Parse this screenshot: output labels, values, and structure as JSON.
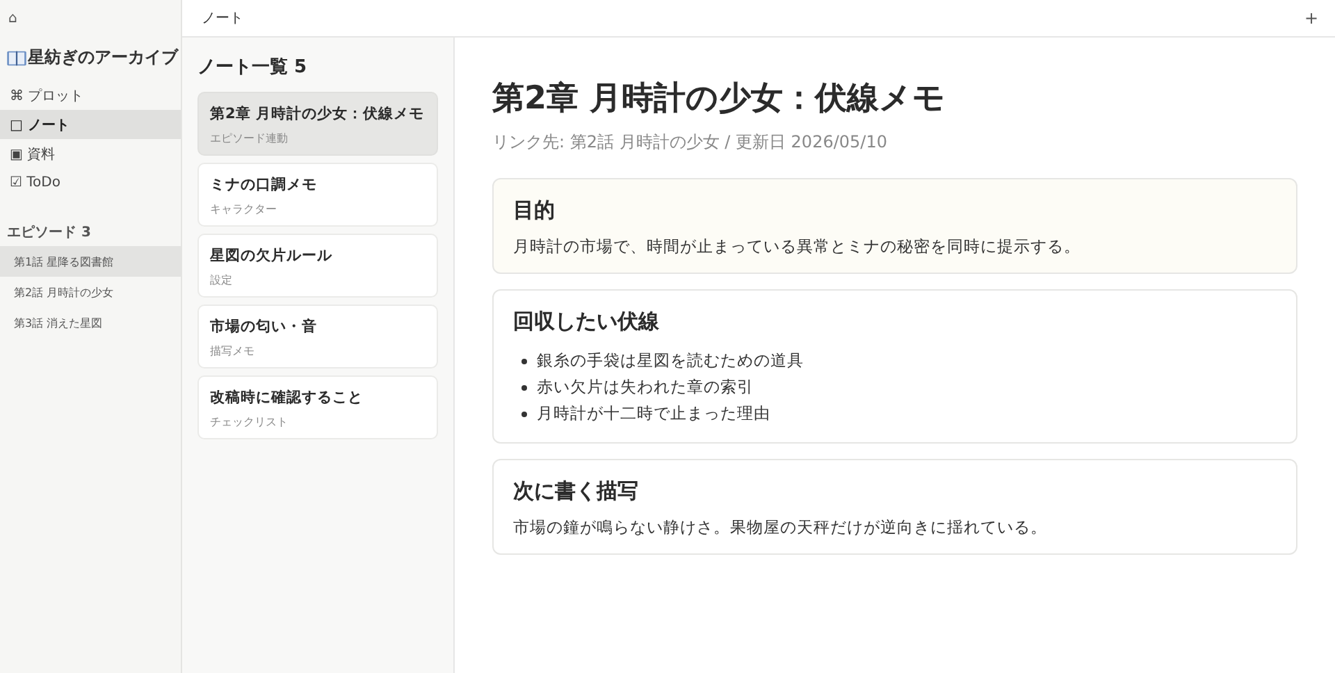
{
  "sidebar": {
    "home": "⌂",
    "title": "星紡ぎのアーカイブ",
    "nav": [
      {
        "label": "⌘ プロット",
        "selected": false
      },
      {
        "label": "□ ノート",
        "selected": true
      },
      {
        "label": "▣ 資料",
        "selected": false
      },
      {
        "label": "☑ ToDo",
        "selected": false
      }
    ],
    "episodes_heading": "エピソード 3",
    "episodes": [
      {
        "label": "第1話 星降る図書館",
        "selected": true
      },
      {
        "label": "第2話 月時計の少女",
        "selected": false
      },
      {
        "label": "第3話 消えた星図",
        "selected": false
      }
    ]
  },
  "header": {
    "title": "ノート",
    "add": "+"
  },
  "note_list": {
    "heading": "ノート一覧 5",
    "notes": [
      {
        "title": "第2章 月時計の少女：伏線メモ",
        "tag": "エピソード連動",
        "selected": true
      },
      {
        "title": "ミナの口調メモ",
        "tag": "キャラクター",
        "selected": false
      },
      {
        "title": "星図の欠片ルール",
        "tag": "設定",
        "selected": false
      },
      {
        "title": "市場の匂い・音",
        "tag": "描写メモ",
        "selected": false
      },
      {
        "title": "改稿時に確認すること",
        "tag": "チェックリスト",
        "selected": false
      }
    ]
  },
  "note": {
    "title": "第2章 月時計の少女：伏線メモ",
    "meta": "リンク先: 第2話 月時計の少女 / 更新日 2026/05/10",
    "sections": [
      {
        "kind": "highlight",
        "heading": "目的",
        "text": "月時計の市場で、時間が止まっている異常とミナの秘密を同時に提示する。"
      },
      {
        "kind": "list",
        "heading": "回収したい伏線",
        "items": [
          "銀糸の手袋は星図を読むための道具",
          "赤い欠片は失われた章の索引",
          "月時計が十二時で止まった理由"
        ]
      },
      {
        "kind": "plain",
        "heading": "次に書く描写",
        "text": "市場の鐘が鳴らない静けさ。果物屋の天秤だけが逆向きに揺れている。"
      }
    ]
  }
}
